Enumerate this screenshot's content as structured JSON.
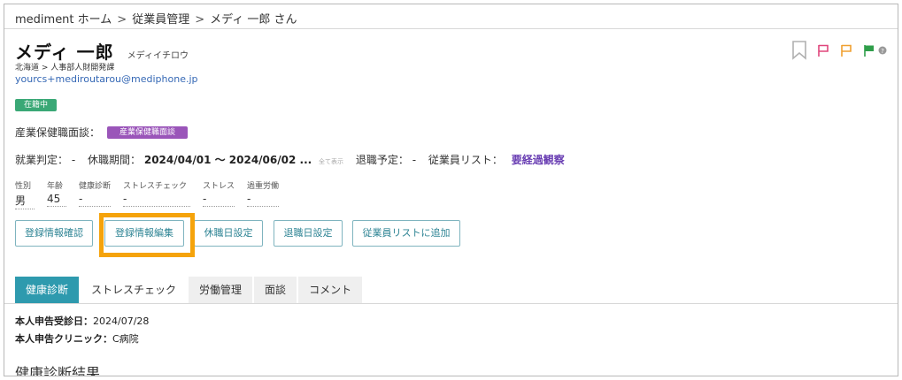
{
  "breadcrumb": {
    "home": "mediment ホーム",
    "employee_mgmt": "従業員管理",
    "current": "メディ 一郎 さん",
    "separator": ">"
  },
  "employee": {
    "name": "メディ 一郎",
    "kana": "メディイチロウ",
    "department": "北海道 > 人事部人財開発課",
    "email": "yourcs+mediroutarou@mediphone.jp",
    "status": "在籍中"
  },
  "consultation": {
    "label": "産業保健職面談：",
    "badge": "産業保健職面談"
  },
  "employment": {
    "judgment_label": "就業判定：",
    "judgment_value": "-",
    "leave_label": "休職期間：",
    "leave_value": "2024/04/01 ～ 2024/06/02 ...",
    "show_all": "全て表示",
    "retire_label": "退職予定：",
    "retire_value": "-",
    "list_label": "従業員リスト：",
    "list_value": "要経過観察"
  },
  "stats": [
    {
      "label": "性別",
      "value": "男"
    },
    {
      "label": "年齢",
      "value": "45"
    },
    {
      "label": "健康診断",
      "value": "-"
    },
    {
      "label": "ストレスチェック",
      "value": "-"
    },
    {
      "label": "ストレス",
      "value": "-"
    },
    {
      "label": "過重労働",
      "value": "-"
    }
  ],
  "actions": {
    "confirm": "登録情報確認",
    "edit": "登録情報編集",
    "leave_date": "休職日設定",
    "retire_date": "退職日設定",
    "add_to_list": "従業員リストに追加"
  },
  "tabs": [
    {
      "label": "健康診断"
    },
    {
      "label": "ストレスチェック"
    },
    {
      "label": "労働管理"
    },
    {
      "label": "面談"
    },
    {
      "label": "コメント"
    }
  ],
  "checkup": {
    "date_label": "本人申告受診日：",
    "date_value": "2024/07/28",
    "clinic_label": "本人申告クリニック：",
    "clinic_value": "C病院",
    "results_title": "健康診断結果"
  },
  "colors": {
    "accent": "#2e9aae",
    "status_green": "#3aa876",
    "consult_purple": "#9a55b9",
    "highlight": "#f5a30b",
    "flag_pink": "#e0467c",
    "flag_orange": "#f0a030",
    "flag_green": "#2f9e4a"
  }
}
